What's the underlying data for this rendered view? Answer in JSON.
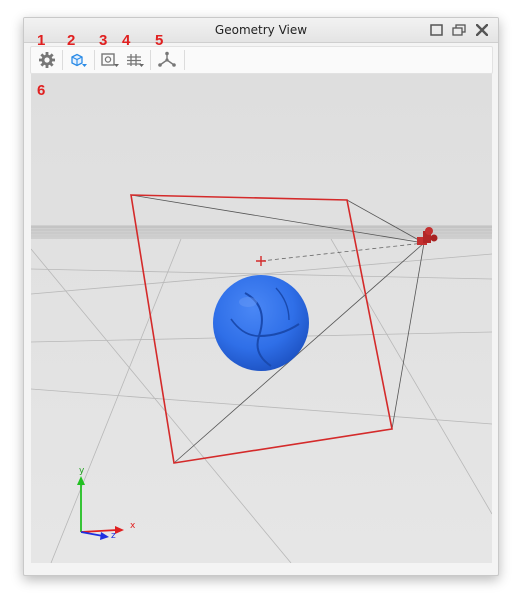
{
  "window": {
    "title": "Geometry View"
  },
  "callouts": [
    "1",
    "2",
    "3",
    "4",
    "5",
    "6"
  ],
  "toolbar": {
    "icons": [
      "gear-icon",
      "view-cube-icon",
      "camera-icon",
      "grid-icon",
      "axes-icon"
    ]
  },
  "window_buttons": [
    "maximize-icon",
    "restore-icon",
    "close-icon"
  ],
  "axes": {
    "y": "y",
    "x": "x",
    "z": "z"
  },
  "colors": {
    "accent": "#e02020",
    "sphere": "#2f6fe8",
    "frustum": "#d42a2a",
    "axis_x": "#e02020",
    "axis_y": "#22c022",
    "axis_z": "#1e2fe0"
  }
}
